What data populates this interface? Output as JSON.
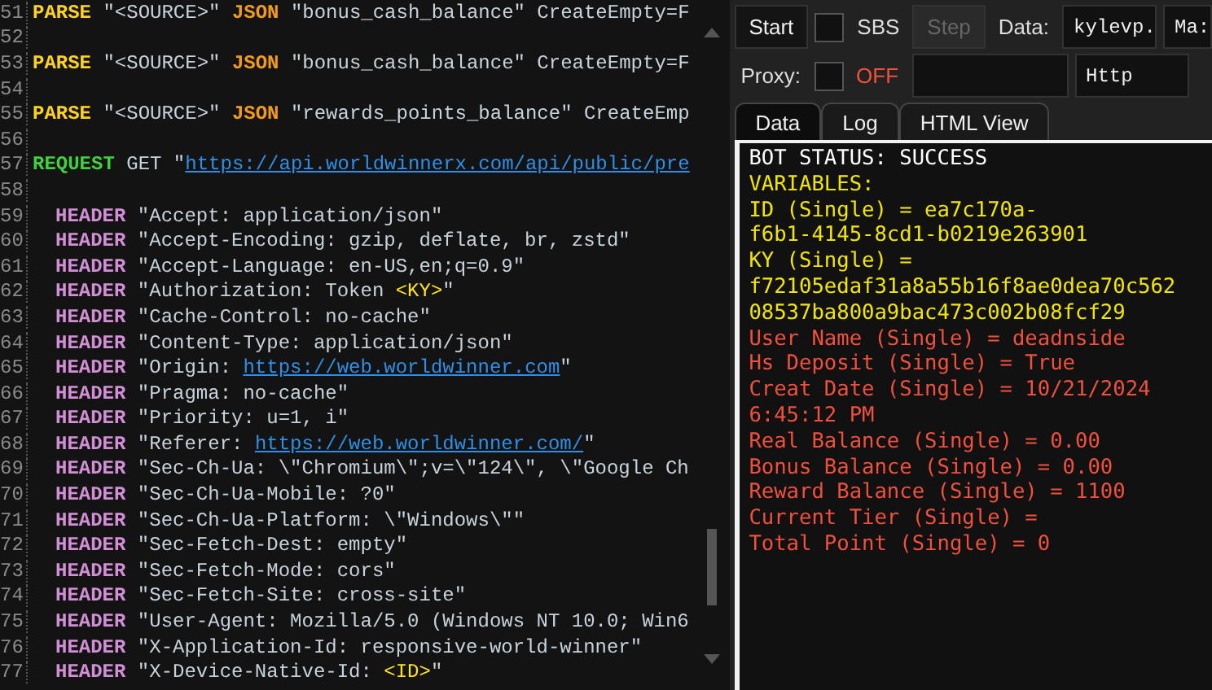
{
  "editor": {
    "lines": [
      {
        "number": "51",
        "segments": [
          {
            "kind": "parse",
            "text": "PARSE"
          },
          {
            "kind": "plain",
            "text": " \"<SOURCE>\" "
          },
          {
            "kind": "json",
            "text": "JSON"
          },
          {
            "kind": "plain",
            "text": " \"bonus_cash_balance\" CreateEmpty=F"
          }
        ]
      },
      {
        "number": "52"
      },
      {
        "number": "53",
        "segments": [
          {
            "kind": "parse",
            "text": "PARSE"
          },
          {
            "kind": "plain",
            "text": " \"<SOURCE>\" "
          },
          {
            "kind": "json",
            "text": "JSON"
          },
          {
            "kind": "plain",
            "text": " \"bonus_cash_balance\" CreateEmpty=F"
          }
        ]
      },
      {
        "number": "54"
      },
      {
        "number": "55",
        "segments": [
          {
            "kind": "parse",
            "text": "PARSE"
          },
          {
            "kind": "plain",
            "text": " \"<SOURCE>\" "
          },
          {
            "kind": "json",
            "text": "JSON"
          },
          {
            "kind": "plain",
            "text": " \"rewards_points_balance\" CreateEmp"
          }
        ]
      },
      {
        "number": "56"
      },
      {
        "number": "57",
        "segments": [
          {
            "kind": "request",
            "text": "REQUEST"
          },
          {
            "kind": "plain",
            "text": " GET \""
          },
          {
            "kind": "url",
            "text": "https://api.worldwinnerx.com/api/public/pre"
          }
        ]
      },
      {
        "number": "58"
      },
      {
        "number": "59",
        "segments": [
          {
            "kind": "header",
            "text": "HEADER"
          },
          {
            "kind": "plain",
            "text": " \"Accept: application/json\""
          }
        ]
      },
      {
        "number": "60",
        "segments": [
          {
            "kind": "header",
            "text": "HEADER"
          },
          {
            "kind": "plain",
            "text": " \"Accept-Encoding: gzip, deflate, br, zstd\""
          }
        ]
      },
      {
        "number": "61",
        "segments": [
          {
            "kind": "header",
            "text": "HEADER"
          },
          {
            "kind": "plain",
            "text": " \"Accept-Language: en-US,en;q=0.9\""
          }
        ]
      },
      {
        "number": "62",
        "segments": [
          {
            "kind": "header",
            "text": "HEADER"
          },
          {
            "kind": "plain",
            "text": " \"Authorization: Token "
          },
          {
            "kind": "variable",
            "text": "<KY>"
          },
          {
            "kind": "plain",
            "text": "\""
          }
        ]
      },
      {
        "number": "63",
        "segments": [
          {
            "kind": "header",
            "text": "HEADER"
          },
          {
            "kind": "plain",
            "text": " \"Cache-Control: no-cache\""
          }
        ]
      },
      {
        "number": "64",
        "segments": [
          {
            "kind": "header",
            "text": "HEADER"
          },
          {
            "kind": "plain",
            "text": " \"Content-Type: application/json\""
          }
        ]
      },
      {
        "number": "65",
        "segments": [
          {
            "kind": "header",
            "text": "HEADER"
          },
          {
            "kind": "plain",
            "text": " \"Origin: "
          },
          {
            "kind": "url",
            "text": "https://web.worldwinner.com"
          },
          {
            "kind": "plain",
            "text": "\""
          }
        ]
      },
      {
        "number": "66",
        "segments": [
          {
            "kind": "header",
            "text": "HEADER"
          },
          {
            "kind": "plain",
            "text": " \"Pragma: no-cache\""
          }
        ]
      },
      {
        "number": "67",
        "segments": [
          {
            "kind": "header",
            "text": "HEADER"
          },
          {
            "kind": "plain",
            "text": " \"Priority: u=1, i\""
          }
        ]
      },
      {
        "number": "68",
        "segments": [
          {
            "kind": "header",
            "text": "HEADER"
          },
          {
            "kind": "plain",
            "text": " \"Referer: "
          },
          {
            "kind": "url",
            "text": "https://web.worldwinner.com/"
          },
          {
            "kind": "plain",
            "text": "\""
          }
        ]
      },
      {
        "number": "69",
        "segments": [
          {
            "kind": "header",
            "text": "HEADER"
          },
          {
            "kind": "plain",
            "text": " \"Sec-Ch-Ua: \\\"Chromium\\\";v=\\\"124\\\", \\\"Google Ch"
          }
        ]
      },
      {
        "number": "70",
        "segments": [
          {
            "kind": "header",
            "text": "HEADER"
          },
          {
            "kind": "plain",
            "text": " \"Sec-Ch-Ua-Mobile: ?0\""
          }
        ]
      },
      {
        "number": "71",
        "segments": [
          {
            "kind": "header",
            "text": "HEADER"
          },
          {
            "kind": "plain",
            "text": " \"Sec-Ch-Ua-Platform: \\\"Windows\\\"\""
          }
        ]
      },
      {
        "number": "72",
        "segments": [
          {
            "kind": "header",
            "text": "HEADER"
          },
          {
            "kind": "plain",
            "text": " \"Sec-Fetch-Dest: empty\""
          }
        ]
      },
      {
        "number": "73",
        "segments": [
          {
            "kind": "header",
            "text": "HEADER"
          },
          {
            "kind": "plain",
            "text": " \"Sec-Fetch-Mode: cors\""
          }
        ]
      },
      {
        "number": "74",
        "segments": [
          {
            "kind": "header",
            "text": "HEADER"
          },
          {
            "kind": "plain",
            "text": " \"Sec-Fetch-Site: cross-site\""
          }
        ]
      },
      {
        "number": "75",
        "segments": [
          {
            "kind": "header",
            "text": "HEADER"
          },
          {
            "kind": "plain",
            "text": " \"User-Agent: Mozilla/5.0 (Windows NT 10.0; Win6"
          }
        ]
      },
      {
        "number": "76",
        "segments": [
          {
            "kind": "header",
            "text": "HEADER"
          },
          {
            "kind": "plain",
            "text": " \"X-Application-Id: responsive-world-winner\""
          }
        ]
      },
      {
        "number": "77",
        "segments": [
          {
            "kind": "header",
            "text": "HEADER"
          },
          {
            "kind": "plain",
            "text": " \"X-Device-Native-Id: "
          },
          {
            "kind": "variable",
            "text": "<ID>"
          },
          {
            "kind": "plain",
            "text": "\""
          }
        ]
      }
    ]
  },
  "toolbar": {
    "start": "Start",
    "sbs": {
      "label": "SBS",
      "checked": false
    },
    "step": {
      "label": "Step",
      "disabled": true
    },
    "data_label": "Data:",
    "data_value": "kylevp.",
    "mode_value": "Ma:",
    "proxy": {
      "label": "Proxy:",
      "checked": false,
      "status": "OFF"
    },
    "proxy_type": "Http"
  },
  "tabs": [
    {
      "label": "Data",
      "selected": true
    },
    {
      "label": "Log",
      "selected": false
    },
    {
      "label": "HTML View",
      "selected": false
    }
  ],
  "output": [
    {
      "text": "BOT STATUS: SUCCESS",
      "color": "#ffffff"
    },
    {
      "text": "VARIABLES:",
      "color": "#f2e600"
    },
    {
      "text": "ID (Single) = ea7c170a-",
      "color": "#f2e600"
    },
    {
      "text": "f6b1-4145-8cd1-b0219e263901",
      "color": "#f2e600"
    },
    {
      "text": "KY (Single) =",
      "color": "#f2e600"
    },
    {
      "text": "f72105edaf31a8a55b16f8ae0dea70c562",
      "color": "#f2e600"
    },
    {
      "text": "08537ba800a9bac473c002b08fcf29",
      "color": "#f2e600"
    },
    {
      "text": "User Name (Single) = deadnside",
      "color": "#f0503c"
    },
    {
      "text": "Hs Deposit (Single) = True",
      "color": "#f0503c"
    },
    {
      "text": "Creat Date (Single) = 10/21/2024",
      "color": "#f0503c"
    },
    {
      "text": "6:45:12 PM",
      "color": "#f0503c"
    },
    {
      "text": "Real Balance (Single) = 0.00",
      "color": "#f0503c"
    },
    {
      "text": "Bonus Balance (Single) = 0.00",
      "color": "#f0503c"
    },
    {
      "text": "Reward Balance (Single) = 1100",
      "color": "#f0503c"
    },
    {
      "text": "Current Tier (Single) =",
      "color": "#f0503c"
    },
    {
      "text": "Total Point (Single) = 0",
      "color": "#f0503c"
    }
  ]
}
